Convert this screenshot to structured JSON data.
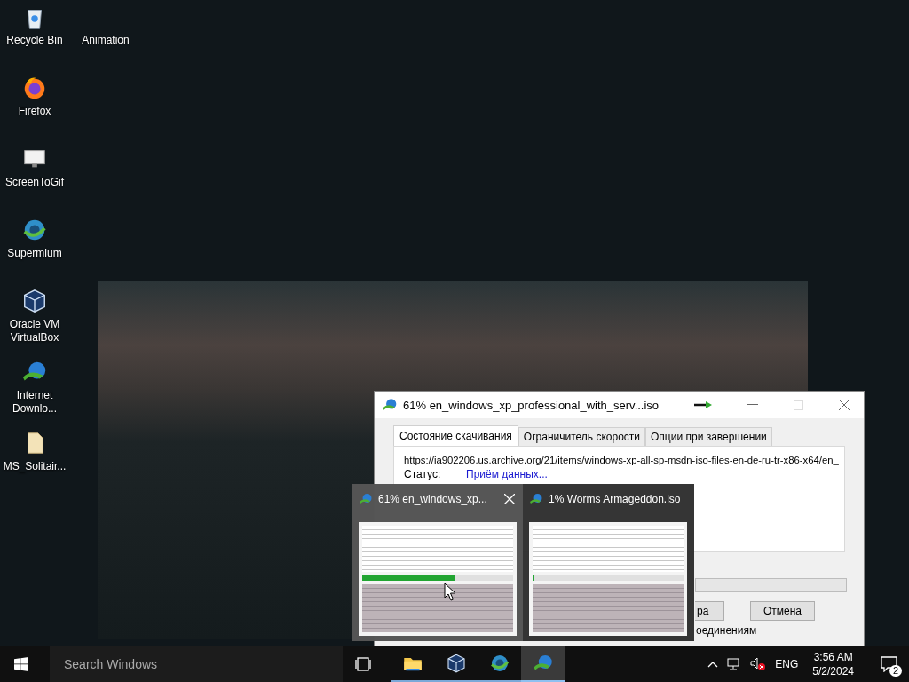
{
  "desktop_icons": [
    {
      "label": "Recycle Bin",
      "kind": "recycle"
    },
    {
      "label": "Animation",
      "kind": "none"
    },
    {
      "label": "Firefox",
      "kind": "firefox"
    },
    {
      "label": "ScreenToGif",
      "kind": "monitor"
    },
    {
      "label": "Supermium",
      "kind": "globe"
    },
    {
      "label": "Oracle VM VirtualBox",
      "kind": "cube"
    },
    {
      "label": "Internet Downlo...",
      "kind": "download"
    },
    {
      "label": "MS_Solitair...",
      "kind": "file"
    }
  ],
  "download_window": {
    "title": "61% en_windows_xp_professional_with_serv...iso",
    "tabs": [
      {
        "label": "Состояние скачивания",
        "selected": true
      },
      {
        "label": "Ограничитель скорости",
        "selected": false
      },
      {
        "label": "Опции при завершении",
        "selected": false
      }
    ],
    "url": "https://ia902206.us.archive.org/21/items/windows-xp-all-sp-msdn-iso-files-en-de-ru-tr-x86-x64/en_",
    "status_label": "Статус:",
    "status_value": "Приём данных...",
    "partial_button": "ра",
    "cancel_button": "Отмена",
    "connections_text": "оединениям"
  },
  "taskbar_previews": [
    {
      "title": "61% en_windows_xp...",
      "level": 0.61,
      "selected": true
    },
    {
      "title": "1% Worms Armageddon.iso",
      "level": 0.01,
      "selected": false
    }
  ],
  "taskbar": {
    "search_placeholder": "Search Windows",
    "apps": [
      {
        "kind": "folder",
        "selected": false
      },
      {
        "kind": "cube",
        "selected": false
      },
      {
        "kind": "globe",
        "selected": false
      },
      {
        "kind": "download",
        "selected": true
      }
    ],
    "language": "ENG",
    "time": "3:56 AM",
    "date": "5/2/2024",
    "notification_count": "2"
  }
}
